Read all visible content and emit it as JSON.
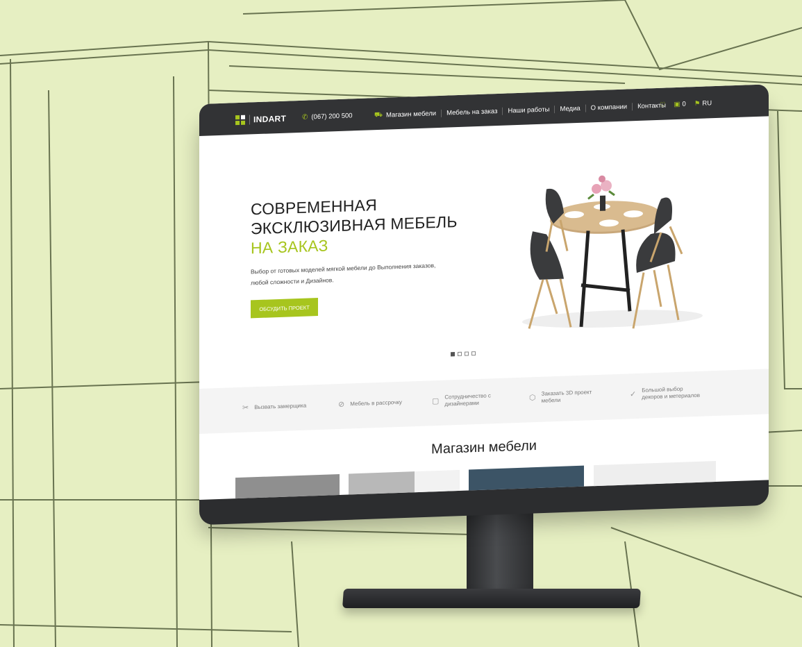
{
  "nav": {
    "logo_text": "INDART",
    "phone": "(067) 200 500",
    "menu": [
      "Магазин мебели",
      "Мебель на заказ",
      "Наши работы",
      "Медиа",
      "О компании",
      "Контакты"
    ],
    "cart_count": "0",
    "language": "RU"
  },
  "hero": {
    "title_line1": "СОВРЕМЕННАЯ",
    "title_line2": "ЭКСКЛЮЗИВНАЯ МЕБЕЛЬ",
    "title_accent": "НА ЗАКАЗ",
    "text_line1": "Выбор от готовых моделей мягкой мебели до Выполнения заказов,",
    "text_line2": "любой сложности и Дизайнов.",
    "button_label": "ОБСУДИТЬ ПРОЕКТ",
    "slides_total": 4,
    "slide_active": 1
  },
  "features": [
    {
      "icon": "ruler-pencil-icon",
      "line1": "Вызвать замерщика",
      "line2": ""
    },
    {
      "icon": "coin-icon",
      "line1": "Мебель в рассрочку",
      "line2": ""
    },
    {
      "icon": "briefcase-icon",
      "line1": "Сотрудничество с",
      "line2": "дизайнерами"
    },
    {
      "icon": "cube-icon",
      "line1": "Заказать 3D проект",
      "line2": "мебели"
    },
    {
      "icon": "check-circle-icon",
      "line1": "Большой выбор",
      "line2": "декоров и метериалов"
    }
  ],
  "shop": {
    "title": "Магазин мебели"
  },
  "colors": {
    "accent": "#a7c51e",
    "nav_bg": "#323335",
    "background": "#e6efc2"
  }
}
